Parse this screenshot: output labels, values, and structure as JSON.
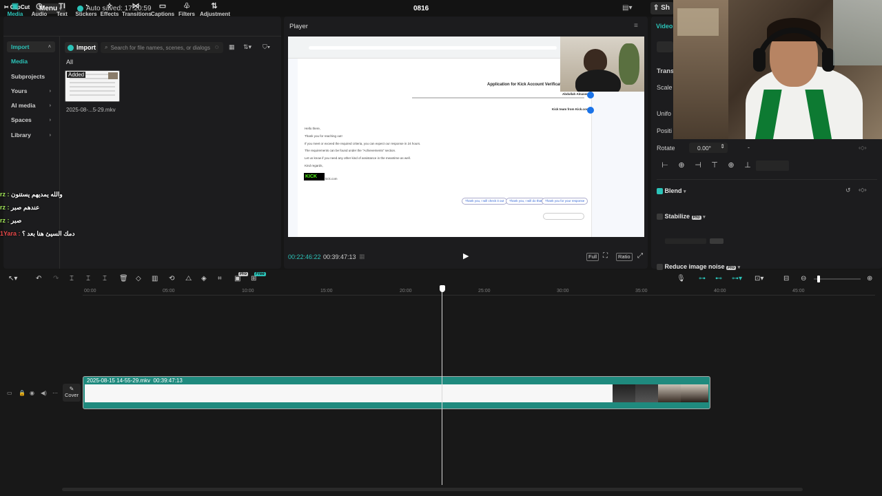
{
  "app": {
    "logo": "CapCut",
    "menu_label": "Menu",
    "autosave": "Auto saved: 17:20:59",
    "project_title": "0816",
    "right_tab_partial": "Sh"
  },
  "toolbar": {
    "tabs": [
      {
        "label": "Media",
        "icon": "media-icon"
      },
      {
        "label": "Audio",
        "icon": "audio-icon"
      },
      {
        "label": "Text",
        "icon": "text-icon"
      },
      {
        "label": "Stickers",
        "icon": "sticker-icon"
      },
      {
        "label": "Effects",
        "icon": "effects-icon"
      },
      {
        "label": "Transitions",
        "icon": "transitions-icon"
      },
      {
        "label": "Captions",
        "icon": "captions-icon"
      },
      {
        "label": "Filters",
        "icon": "filters-icon"
      },
      {
        "label": "Adjustment",
        "icon": "adjustment-icon"
      }
    ]
  },
  "sidebar": {
    "items": [
      {
        "label": "Import"
      },
      {
        "label": "Media"
      },
      {
        "label": "Subprojects"
      },
      {
        "label": "Yours"
      },
      {
        "label": "AI media"
      },
      {
        "label": "Spaces"
      },
      {
        "label": "Library"
      }
    ]
  },
  "media": {
    "import_label": "Import",
    "search_placeholder": "Search for file names, scenes, or dialogs",
    "filter_label": "All",
    "clip_badge": "Added",
    "clip_name": "2025-08-...5-29.mkv"
  },
  "chat_overlay": [
    {
      "name": "rz : ",
      "msg": "والله يمديهم يستنون"
    },
    {
      "name": "rz : ",
      "msg": "عندهم صبر"
    },
    {
      "name": "rz : ",
      "msg": "صبر"
    },
    {
      "name": "1Yara : ",
      "msg": "دمك السيئ هنا بعد ؟"
    }
  ],
  "player": {
    "title": "Player",
    "current_time": "00:22:46:22",
    "total_time": "00:39:47:13",
    "full_label": "Full",
    "ratio_label": "Ratio",
    "email": {
      "subject": "Application for Kick Account Verification",
      "sender_top": "Abdullah Alnaser",
      "sender_reply": "Kick team from Kick.com",
      "body": [
        "Hello there,",
        "Thank you for reaching out!",
        "If you meet or exceed the required criteria, you can expect our response in 24 hours.",
        "The requirements can be found under the \"Achievements\" section.",
        "Let us know if you need any other kind of assistance in the meantime as well.",
        "Kind regards,"
      ],
      "logo_text": "KICK",
      "logo_site": "kick.com",
      "smart_replies": [
        "Thank you, I will check it out",
        "Thank you, I will do that",
        "Thank you for your response"
      ]
    }
  },
  "inspector": {
    "tab": "Video",
    "section_transform": "Transf",
    "scale_label": "Scale",
    "uniform_label": "Unifo",
    "position_label": "Positi",
    "rotate_label": "Rotate",
    "rotate_value": "0.00°",
    "rotate_extra": "-",
    "blend_label": "Blend",
    "stabilize_label": "Stabilize",
    "reduce_noise_label": "Reduce image noise",
    "pro_badge": "Pro",
    "accent": "#2bc3b8"
  },
  "timeline": {
    "ruler": [
      "00:00",
      "05:00",
      "10:00",
      "15:00",
      "20:00",
      "25:00",
      "30:00",
      "35:00",
      "40:00",
      "45:00"
    ],
    "clip_name": "2025-08-15 14-55-29.mkv",
    "clip_duration": "00:39:47:13",
    "cover_label": "Cover",
    "pro_badge": "Pro",
    "free_badge": "Free"
  }
}
